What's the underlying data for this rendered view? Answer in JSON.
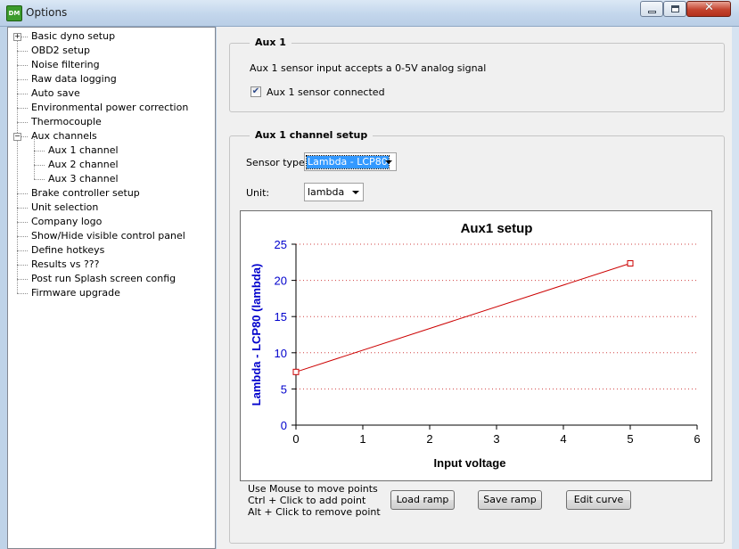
{
  "window": {
    "title": "Options",
    "icon": "app-logo-icon",
    "icon_text": "DM"
  },
  "tree": {
    "items": [
      {
        "label": "Basic dyno setup",
        "level": 0,
        "expandable": true
      },
      {
        "label": "OBD2 setup",
        "level": 0
      },
      {
        "label": "Noise filtering",
        "level": 0
      },
      {
        "label": "Raw data logging",
        "level": 0
      },
      {
        "label": "Auto save",
        "level": 0
      },
      {
        "label": "Environmental power correction",
        "level": 0
      },
      {
        "label": "Thermocouple",
        "level": 0
      },
      {
        "label": "Aux channels",
        "level": 0,
        "expanded": true
      },
      {
        "label": "Aux 1 channel",
        "level": 1
      },
      {
        "label": "Aux 2 channel",
        "level": 1
      },
      {
        "label": "Aux 3 channel",
        "level": 1
      },
      {
        "label": "Brake controller setup",
        "level": 0
      },
      {
        "label": "Unit selection",
        "level": 0
      },
      {
        "label": "Company logo",
        "level": 0
      },
      {
        "label": "Show/Hide visible control panel",
        "level": 0
      },
      {
        "label": "Define hotkeys",
        "level": 0
      },
      {
        "label": "Results vs ???",
        "level": 0
      },
      {
        "label": "Post run Splash screen config",
        "level": 0
      },
      {
        "label": "Firmware upgrade",
        "level": 0
      }
    ]
  },
  "aux_group": {
    "title": "Aux 1",
    "description": "Aux 1 sensor input accepts a 0-5V analog signal",
    "checkbox_label": "Aux 1 sensor connected",
    "checked": true
  },
  "channel_group": {
    "title": "Aux 1 channel setup",
    "sensor_type_label": "Sensor type:",
    "sensor_type_value": "Lambda - LCP80",
    "unit_label": "Unit:",
    "unit_value": "lambda"
  },
  "chart_data": {
    "type": "line",
    "title": "Aux1 setup",
    "xlabel": "Input voltage",
    "ylabel": "Lambda - LCP80 (lambda)",
    "xlim": [
      0,
      6
    ],
    "ylim": [
      0,
      25
    ],
    "xticks": [
      "0",
      "1",
      "2",
      "3",
      "4",
      "5",
      "6"
    ],
    "yticks": [
      "0",
      "5",
      "10",
      "15",
      "20",
      "25"
    ],
    "grid": "horizontal dotted",
    "series": [
      {
        "x": [
          0,
          5
        ],
        "y": [
          7.35,
          22.35
        ],
        "color": "#cc0000"
      }
    ],
    "colors": {
      "ylabel": "#0000cc",
      "ytick": "#0000cc",
      "line": "#cc0000",
      "grid": "#d04040"
    }
  },
  "hints": [
    "Use Mouse to move points",
    "Ctrl + Click to add point",
    "Alt + Click to remove point"
  ],
  "buttons": {
    "load": "Load ramp",
    "save": "Save ramp",
    "edit": "Edit curve"
  }
}
